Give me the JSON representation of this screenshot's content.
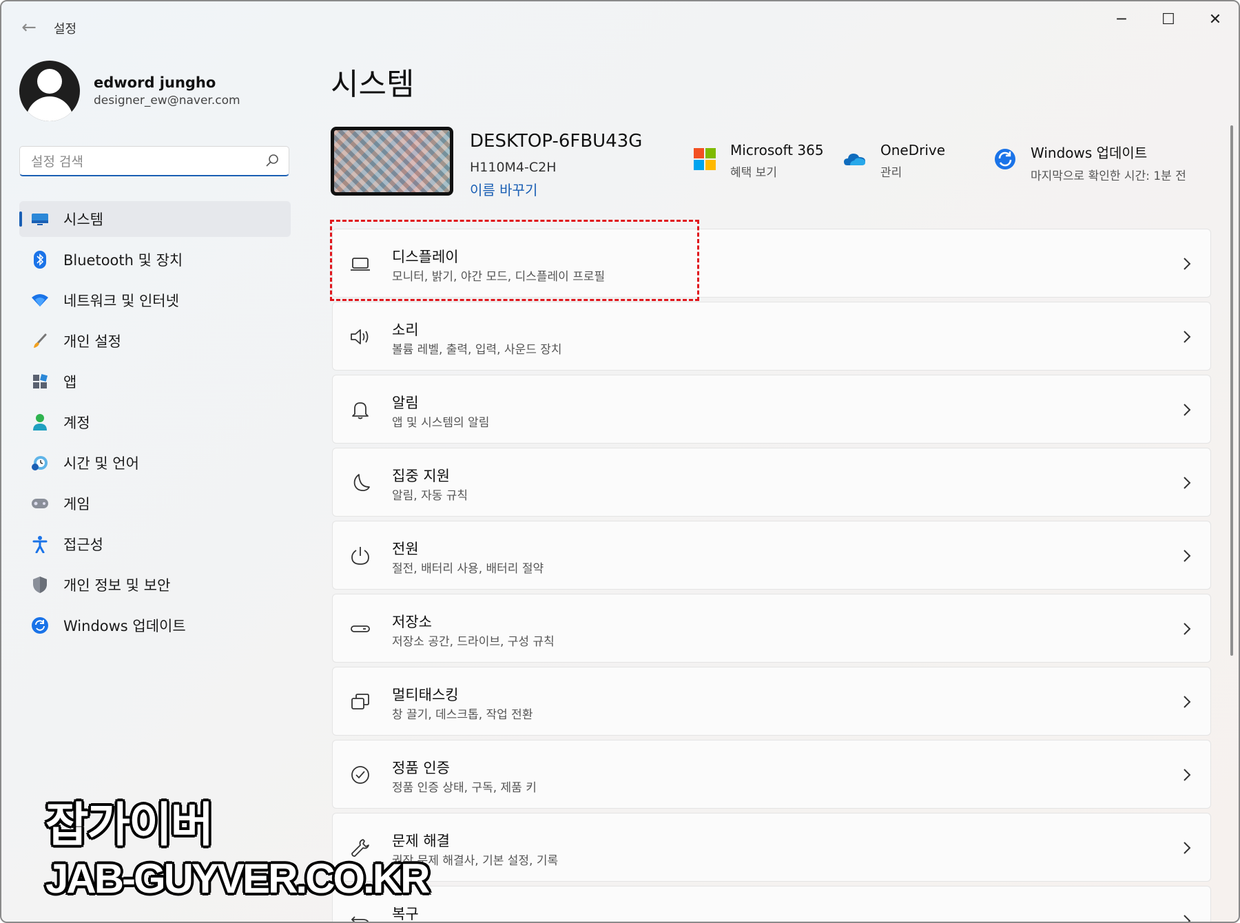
{
  "window": {
    "title": "설정",
    "back_icon": "back-arrow-icon",
    "controls": {
      "minimize": "─",
      "maximize": "☐",
      "close": "✕"
    }
  },
  "profile": {
    "name": "edword jungho",
    "email": "designer_ew@naver.com"
  },
  "search": {
    "placeholder": "설정 검색",
    "value": ""
  },
  "sidebar": {
    "items": [
      {
        "label": "시스템",
        "icon": "system-display-icon",
        "active": true
      },
      {
        "label": "Bluetooth 및 장치",
        "icon": "bluetooth-icon"
      },
      {
        "label": "네트워크 및 인터넷",
        "icon": "wifi-icon"
      },
      {
        "label": "개인 설정",
        "icon": "brush-icon"
      },
      {
        "label": "앱",
        "icon": "apps-icon"
      },
      {
        "label": "계정",
        "icon": "account-icon"
      },
      {
        "label": "시간 및 언어",
        "icon": "time-language-icon"
      },
      {
        "label": "게임",
        "icon": "gamepad-icon"
      },
      {
        "label": "접근성",
        "icon": "accessibility-icon"
      },
      {
        "label": "개인 정보 및 보안",
        "icon": "shield-icon"
      },
      {
        "label": "Windows 업데이트",
        "icon": "windows-update-icon"
      }
    ]
  },
  "main": {
    "title": "시스템",
    "device": {
      "name": "DESKTOP-6FBU43G",
      "model": "H110M4-C2H",
      "rename_label": "이름 바꾸기"
    },
    "quick_links": [
      {
        "title": "Microsoft 365",
        "subtitle": "혜택 보기",
        "icon": "microsoft-logo-icon"
      },
      {
        "title": "OneDrive",
        "subtitle": "관리",
        "icon": "onedrive-cloud-icon"
      },
      {
        "title": "Windows 업데이트",
        "subtitle": "마지막으로 확인한 시간: 1분 전",
        "icon": "windows-update-icon"
      }
    ],
    "cards": [
      {
        "title": "디스플레이",
        "subtitle": "모니터, 밝기, 야간 모드, 디스플레이 프로필",
        "icon": "display-icon"
      },
      {
        "title": "소리",
        "subtitle": "볼륨 레벨, 출력, 입력, 사운드 장치",
        "icon": "speaker-icon"
      },
      {
        "title": "알림",
        "subtitle": "앱 및 시스템의 알림",
        "icon": "bell-icon"
      },
      {
        "title": "집중 지원",
        "subtitle": "알림, 자동 규칙",
        "icon": "moon-icon"
      },
      {
        "title": "전원",
        "subtitle": "절전, 배터리 사용, 배터리 절약",
        "icon": "power-icon"
      },
      {
        "title": "저장소",
        "subtitle": "저장소 공간, 드라이브, 구성 규칙",
        "icon": "storage-icon"
      },
      {
        "title": "멀티태스킹",
        "subtitle": "창 끌기, 데스크톱, 작업 전환",
        "icon": "multitasking-icon"
      },
      {
        "title": "정품 인증",
        "subtitle": "정품 인증 상태, 구독, 제품 키",
        "icon": "checkmark-circle-icon"
      },
      {
        "title": "문제 해결",
        "subtitle": "권장 문제 해결사, 기본 설정, 기록",
        "icon": "wrench-icon"
      },
      {
        "title": "복구",
        "subtitle": "",
        "icon": "recovery-icon"
      }
    ]
  },
  "watermark": {
    "line1": "잡가이버",
    "line2": "JAB-GUYVER.CO.KR"
  },
  "colors": {
    "accent": "#1a5fb4",
    "highlight_border": "#e0161c"
  }
}
